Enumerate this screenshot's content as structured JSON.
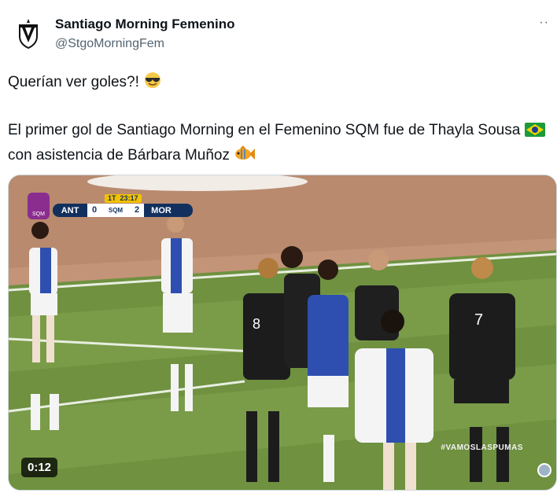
{
  "author": {
    "name": "Santiago Morning Femenino",
    "handle": "@StgoMorningFem"
  },
  "tweet": {
    "line1": "Querían ver goles?!",
    "line1_emoji": "sunglasses-face",
    "line2": "El primer gol de Santiago Morning en el Femenino SQM fue de Thayla Sousa",
    "line2_flag": "brazil-flag",
    "line2_rest": "con asistencia de Bárbara Muñoz",
    "line2_emoji": "tropical-fish"
  },
  "video": {
    "scorebug": {
      "period": "1T",
      "clock": "23:17",
      "home_team": "ANT",
      "home_score": "0",
      "league": "SQM",
      "away_score": "2",
      "away_team": "MOR",
      "logo_text": "SQM"
    },
    "duration": "0:12",
    "hashtag": "#VAMOSLASPUMAS"
  },
  "colors": {
    "text": "#0f1419",
    "secondary": "#536471",
    "scorebug_bg": "#12305e",
    "clock_bg": "#f2c200"
  }
}
